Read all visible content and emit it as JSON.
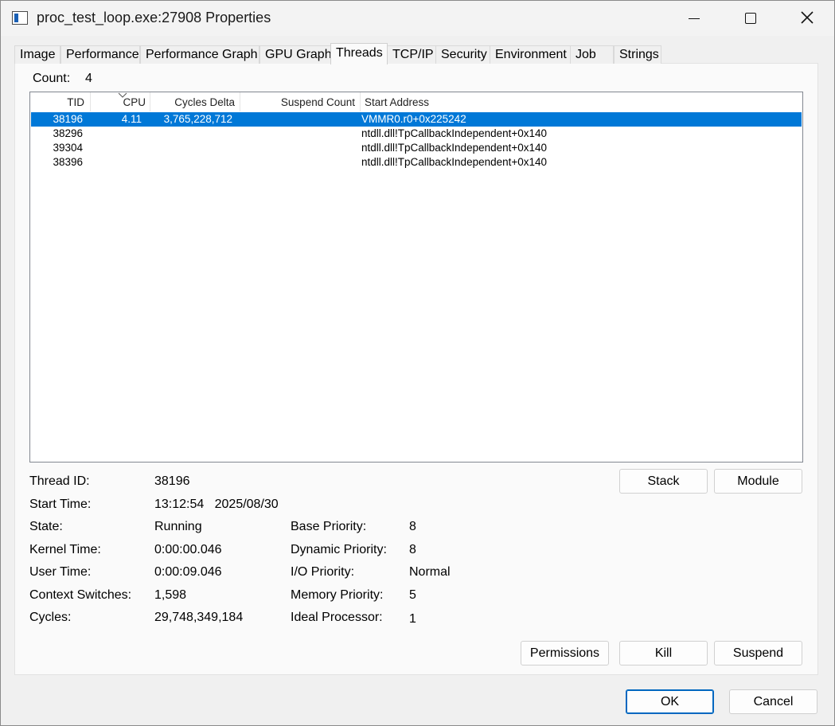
{
  "window": {
    "title": "proc_test_loop.exe:27908 Properties"
  },
  "tabs": [
    {
      "label": "Image"
    },
    {
      "label": "Performance"
    },
    {
      "label": "Performance Graph"
    },
    {
      "label": "GPU Graph"
    },
    {
      "label": "Threads"
    },
    {
      "label": "TCP/IP"
    },
    {
      "label": "Security"
    },
    {
      "label": "Environment"
    },
    {
      "label": "Job"
    },
    {
      "label": "Strings"
    }
  ],
  "active_tab": "Threads",
  "threads": {
    "count_label": "Count:",
    "count_value": "4",
    "columns": [
      "TID",
      "CPU",
      "Cycles Delta",
      "Suspend Count",
      "Start Address"
    ],
    "rows": [
      {
        "tid": "38196",
        "cpu": "4.11",
        "cycles_delta": "3,765,228,712",
        "suspend_count": "",
        "start_address": "VMMR0.r0+0x225242",
        "selected": true
      },
      {
        "tid": "38296",
        "cpu": "",
        "cycles_delta": "",
        "suspend_count": "",
        "start_address": "ntdll.dll!TpCallbackIndependent+0x140",
        "selected": false
      },
      {
        "tid": "39304",
        "cpu": "",
        "cycles_delta": "",
        "suspend_count": "",
        "start_address": "ntdll.dll!TpCallbackIndependent+0x140",
        "selected": false
      },
      {
        "tid": "38396",
        "cpu": "",
        "cycles_delta": "",
        "suspend_count": "",
        "start_address": "ntdll.dll!TpCallbackIndependent+0x140",
        "selected": false
      }
    ]
  },
  "details": {
    "thread_id_label": "Thread ID:",
    "thread_id": "38196",
    "start_time_label": "Start Time:",
    "start_time": "13:12:54   2025/08/30",
    "state_label": "State:",
    "state": "Running",
    "kernel_time_label": "Kernel Time:",
    "kernel_time": "0:00:00.046",
    "user_time_label": "User Time:",
    "user_time": "0:00:09.046",
    "context_switches_label": "Context Switches:",
    "context_switches": "1,598",
    "cycles_label": "Cycles:",
    "cycles": "29,748,349,184",
    "base_priority_label": "Base Priority:",
    "base_priority": "8",
    "dynamic_priority_label": "Dynamic Priority:",
    "dynamic_priority": "8",
    "io_priority_label": "I/O Priority:",
    "io_priority": "Normal",
    "memory_priority_label": "Memory Priority:",
    "memory_priority": "5",
    "ideal_processor_label": "Ideal Processor:",
    "ideal_processor": "1"
  },
  "buttons": {
    "stack": "Stack",
    "module": "Module",
    "permissions": "Permissions",
    "kill": "Kill",
    "suspend": "Suspend",
    "ok": "OK",
    "cancel": "Cancel"
  },
  "colors": {
    "selection": "#0078d7",
    "default_button_border": "#0067c0"
  }
}
